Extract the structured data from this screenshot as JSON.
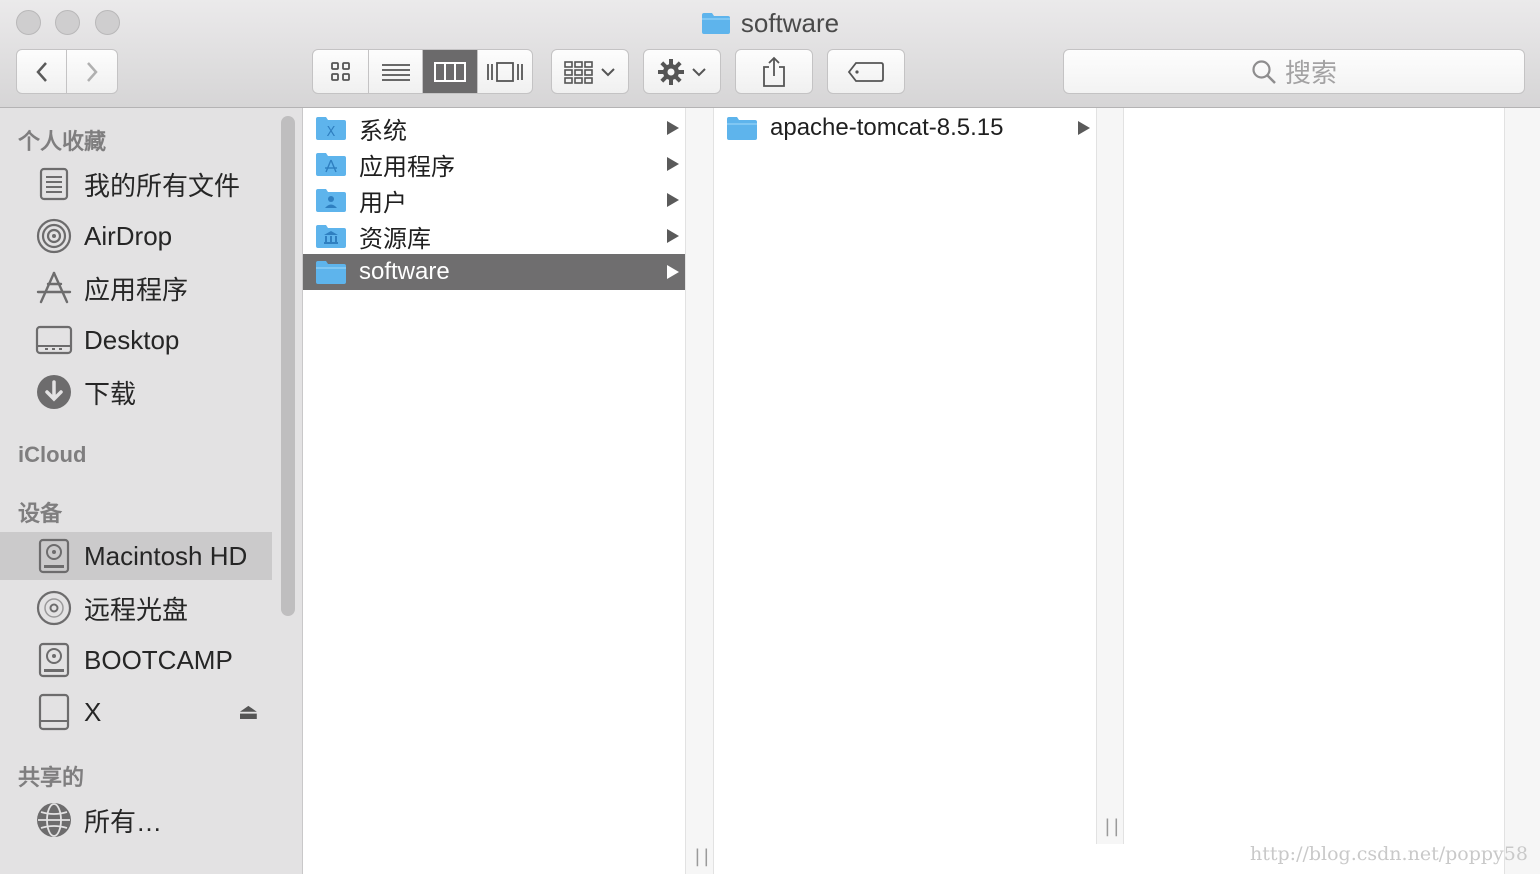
{
  "window": {
    "title": "software"
  },
  "search": {
    "placeholder": "搜索"
  },
  "sidebar": {
    "sections": [
      {
        "header": "个人收藏"
      },
      {
        "header": "iCloud"
      },
      {
        "header": "设备"
      },
      {
        "header": "共享的"
      }
    ],
    "favorites": [
      {
        "label": "我的所有文件",
        "icon": "all-files-icon"
      },
      {
        "label": "AirDrop",
        "icon": "airdrop-icon"
      },
      {
        "label": "应用程序",
        "icon": "applications-icon"
      },
      {
        "label": "Desktop",
        "icon": "desktop-icon"
      },
      {
        "label": "下载",
        "icon": "downloads-icon"
      }
    ],
    "devices": [
      {
        "label": "Macintosh HD",
        "icon": "hard-drive-icon",
        "selected": true
      },
      {
        "label": "远程光盘",
        "icon": "remote-disc-icon"
      },
      {
        "label": "BOOTCAMP",
        "icon": "hard-drive-icon"
      },
      {
        "label": "X",
        "icon": "external-drive-icon"
      }
    ],
    "shared": [
      {
        "label": "所有…",
        "icon": "network-globe-icon"
      }
    ]
  },
  "columns": {
    "col1": [
      {
        "label": "系统",
        "icon": "system-folder-icon",
        "selected": false
      },
      {
        "label": "应用程序",
        "icon": "applications-folder-icon",
        "selected": false
      },
      {
        "label": "用户",
        "icon": "users-folder-icon",
        "selected": false
      },
      {
        "label": "资源库",
        "icon": "library-folder-icon",
        "selected": false
      },
      {
        "label": "software",
        "icon": "folder-icon",
        "selected": true
      }
    ],
    "col2": [
      {
        "label": "apache-tomcat-8.5.15",
        "icon": "folder-icon",
        "selected": false
      }
    ]
  },
  "watermark": "http://blog.csdn.net/poppy58",
  "colors": {
    "folder": "#5eb4ec",
    "selection": "#6f6e6f",
    "sidebar_bg": "#e3e2e3"
  }
}
